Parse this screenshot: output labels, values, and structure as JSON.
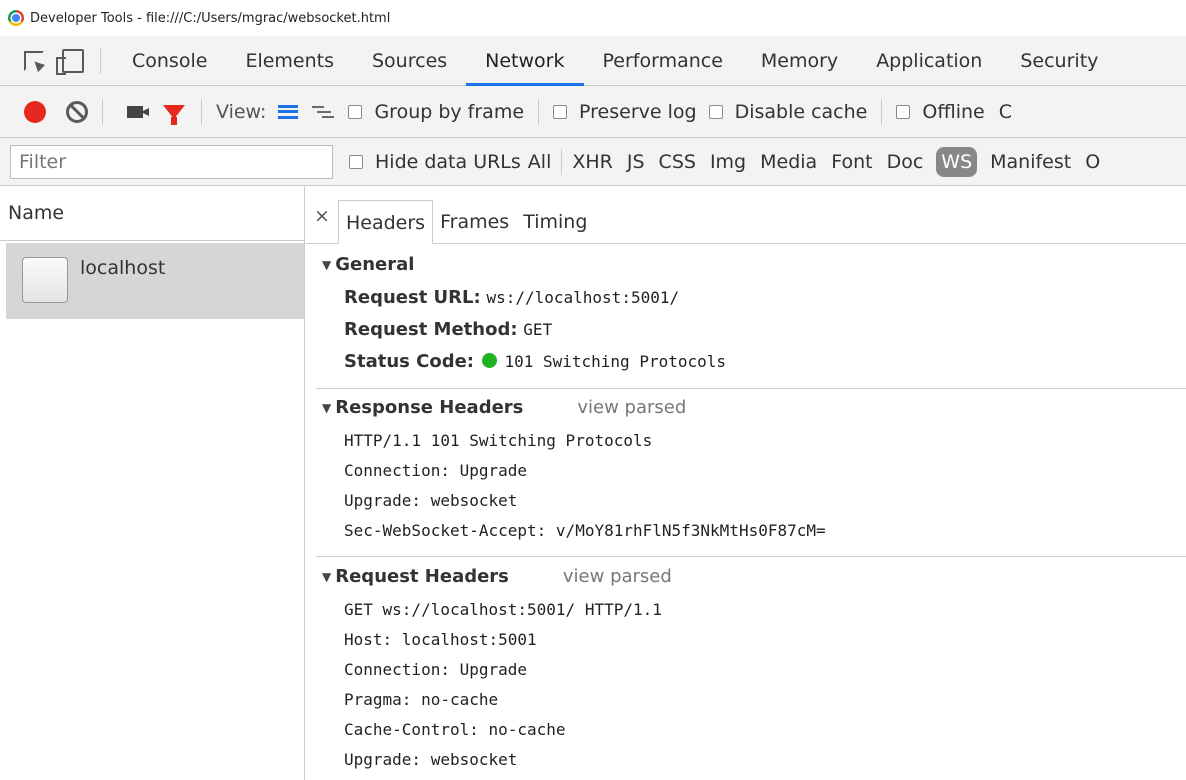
{
  "window": {
    "title": "Developer Tools - file:///C:/Users/mgrac/websocket.html"
  },
  "tabs": [
    {
      "label": "Console"
    },
    {
      "label": "Elements"
    },
    {
      "label": "Sources"
    },
    {
      "label": "Network",
      "active": true
    },
    {
      "label": "Performance"
    },
    {
      "label": "Memory"
    },
    {
      "label": "Application"
    },
    {
      "label": "Security"
    }
  ],
  "toolbar": {
    "view_label": "View:",
    "group_by_frame": "Group by frame",
    "preserve_log": "Preserve log",
    "disable_cache": "Disable cache",
    "offline": "Offline",
    "throttle_partial": "C"
  },
  "filterbar": {
    "placeholder": "Filter",
    "hide_data_urls": "Hide data URLs",
    "types": [
      "All",
      "XHR",
      "JS",
      "CSS",
      "Img",
      "Media",
      "Font",
      "Doc",
      "WS",
      "Manifest",
      "O"
    ],
    "active_type": "WS"
  },
  "requests": {
    "header": "Name",
    "items": [
      {
        "name": "localhost"
      }
    ]
  },
  "detail": {
    "close": "×",
    "tabs": [
      "Headers",
      "Frames",
      "Timing"
    ],
    "general": {
      "title": "General",
      "request_url_key": "Request URL:",
      "request_url": "ws://localhost:5001/",
      "method_key": "Request Method:",
      "method": "GET",
      "status_key": "Status Code:",
      "status": "101 Switching Protocols",
      "status_color": "#1fb41f"
    },
    "response_headers": {
      "title": "Response Headers",
      "view_parsed": "view parsed",
      "lines": [
        "HTTP/1.1 101 Switching Protocols",
        "Connection: Upgrade",
        "Upgrade: websocket",
        "Sec-WebSocket-Accept: v/MoY81rhFlN5f3NkMtHs0F87cM="
      ]
    },
    "request_headers": {
      "title": "Request Headers",
      "view_parsed": "view parsed",
      "lines": [
        "GET ws://localhost:5001/ HTTP/1.1",
        "Host: localhost:5001",
        "Connection: Upgrade",
        "Pragma: no-cache",
        "Cache-Control: no-cache",
        "Upgrade: websocket"
      ]
    }
  },
  "colors": {
    "accent": "#1a73e8",
    "record": "#e6281e",
    "ws_active_bg": "#888888"
  }
}
